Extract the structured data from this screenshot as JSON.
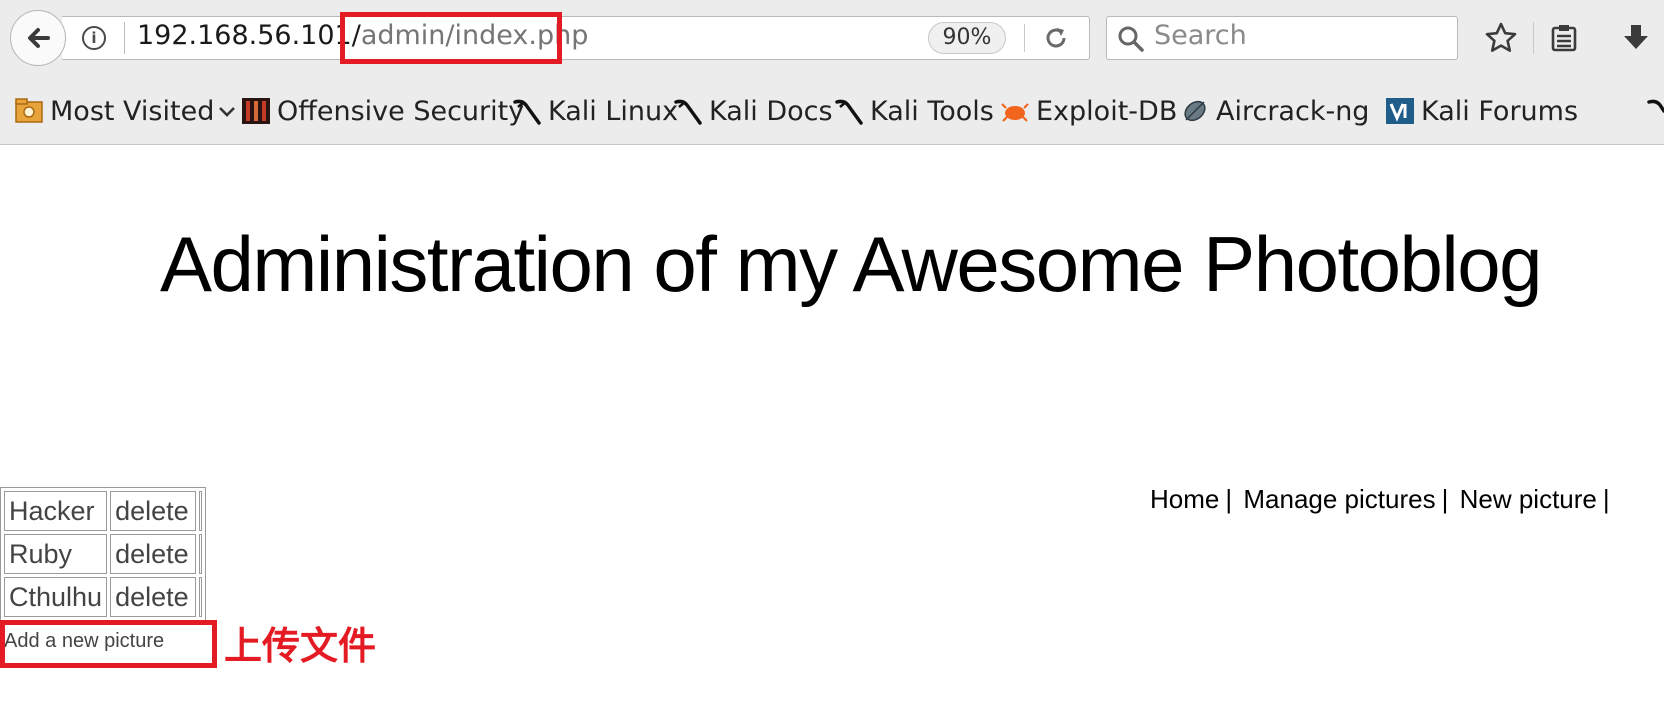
{
  "browser": {
    "url_host": "192.168.56.101/",
    "url_path": "admin/index.php",
    "zoom": "90%",
    "search_placeholder": "Search",
    "bookmarks": [
      {
        "label": "Most Visited",
        "icon": "most-visited-icon"
      },
      {
        "label": "Offensive Security",
        "icon": "offensive-security-icon"
      },
      {
        "label": "Kali Linux",
        "icon": "kali-dragon-icon"
      },
      {
        "label": "Kali Docs",
        "icon": "kali-dragon-icon"
      },
      {
        "label": "Kali Tools",
        "icon": "kali-dragon-icon"
      },
      {
        "label": "Exploit-DB",
        "icon": "exploit-db-icon"
      },
      {
        "label": "Aircrack-ng",
        "icon": "aircrack-icon"
      },
      {
        "label": "Kali Forums",
        "icon": "kali-forums-icon"
      }
    ],
    "colors": {
      "highlight": "#e41b23",
      "chrome_bg": "#ececec"
    }
  },
  "page": {
    "title": "Administration of my Awesome Photoblog",
    "nav": [
      {
        "label": "Home"
      },
      {
        "label": "Manage pictures"
      },
      {
        "label": "New picture"
      }
    ],
    "nav_separator": "|",
    "pictures": [
      {
        "name": "Hacker",
        "action": "delete"
      },
      {
        "name": "Ruby",
        "action": "delete"
      },
      {
        "name": "Cthulhu",
        "action": "delete"
      }
    ],
    "add_link": "Add a new picture"
  },
  "annotation": {
    "text": "上传文件"
  }
}
